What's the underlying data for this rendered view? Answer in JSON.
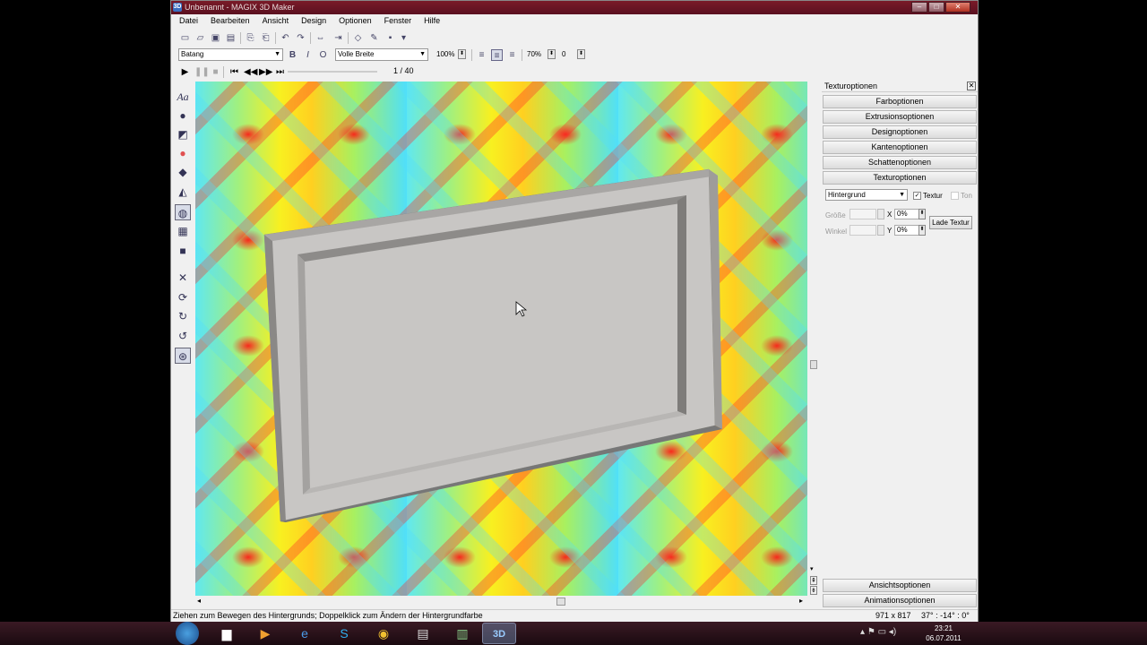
{
  "window": {
    "title": "Unbenannt - MAGIX 3D Maker",
    "app_icon": "3D"
  },
  "menu": [
    "Datei",
    "Bearbeiten",
    "Ansicht",
    "Design",
    "Optionen",
    "Fenster",
    "Hilfe"
  ],
  "toolbar": {
    "font": "Batang",
    "width_mode": "Volle Breite",
    "zoom": "100%",
    "percent2": "70%",
    "value2": "0"
  },
  "animation": {
    "frame": "1 / 40"
  },
  "right_panel": {
    "header": "Texturoptionen",
    "sections": [
      "Farboptionen",
      "Extrusionsoptionen",
      "Designoptionen",
      "Kantenoptionen",
      "Schattenoptionen",
      "Texturoptionen"
    ],
    "texture": {
      "target": "Hintergrund",
      "textur_label": "Textur",
      "ton_label": "Ton",
      "groesse_label": "Größe",
      "winkel_label": "Winkel",
      "x_label": "X",
      "y_label": "Y",
      "x_value": "0%",
      "y_value": "0%",
      "load_button": "Lade Textur"
    },
    "bottom_sections": [
      "Ansichtsoptionen",
      "Animationsoptionen"
    ]
  },
  "status": {
    "hint": "Ziehen zum Bewegen des Hintergrunds; Doppelklick zum Ändern der Hintergrundfarbe",
    "size": "971 x 817",
    "angles": "37° : -14° : 0°"
  },
  "clock": {
    "time": "23:21",
    "date": "06.07.2011"
  },
  "colors": {
    "titlebar": "#6a1424",
    "frame": "#c4c2c0"
  }
}
